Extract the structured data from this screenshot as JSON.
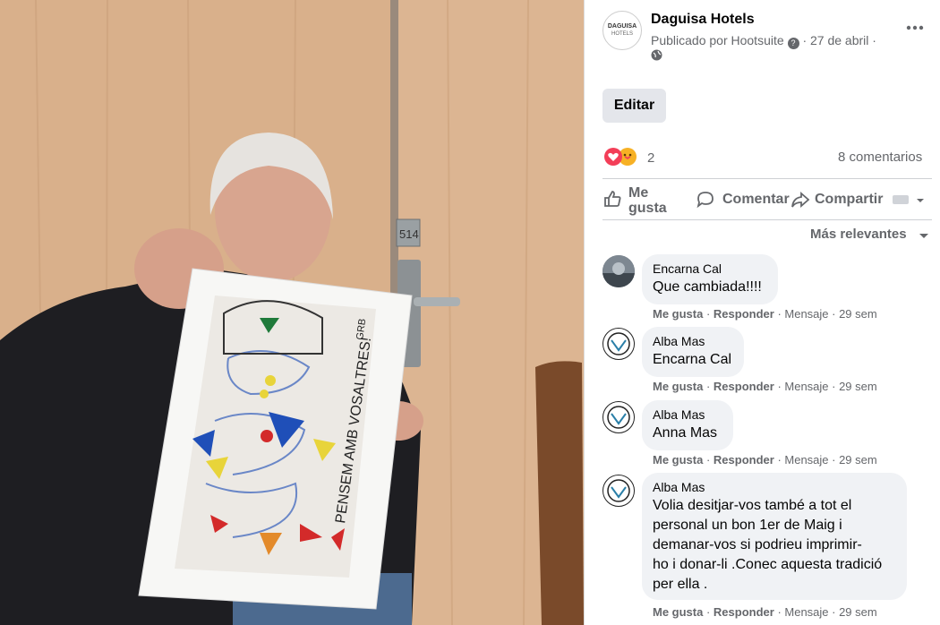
{
  "post": {
    "page_name": "Daguisa Hotels",
    "avatar_text": "DAGUISA",
    "avatar_subtext": "HOTELS",
    "published_by": "Publicado por Hootsuite",
    "date": "27 de abril",
    "dot": "·",
    "more_icon": "more-dots-icon",
    "edit_label": "Editar"
  },
  "reactions": {
    "count": "2",
    "comments_label": "8 comentarios"
  },
  "actions": {
    "like": "Me gusta",
    "comment": "Comentar",
    "share": "Compartir"
  },
  "sort_label": "Más relevantes",
  "comments": [
    {
      "author": "Encarna Cal",
      "text": "Que cambiada!!!!",
      "like": "Me gusta",
      "reply": "Responder",
      "extra": "· Mensaje · 29 sem"
    },
    {
      "author": "Alba Mas",
      "text": "Encarna Cal",
      "like": "Me gusta",
      "reply": "Responder",
      "extra": "· Mensaje · 29 sem"
    },
    {
      "author": "Alba Mas",
      "text": "Anna Mas",
      "like": "Me gusta",
      "reply": "Responder",
      "extra": "· Mensaje · 29 sem"
    },
    {
      "author": "Alba Mas",
      "text_lines": [
        "Volia desitjar-vos també a tot el",
        "personal un bon 1er de Maig i",
        "demanar-vos si podrieu imprimir-",
        "ho i donar-li .Conec aquesta tradició",
        "per ella ."
      ],
      "like": "Me gusta",
      "reply": "Responder",
      "extra": "· Mensaje · 29 sem"
    }
  ],
  "photo": {
    "door_sign": "514",
    "drawing_text": "PENSEM AMB VOSALTRES!",
    "drawing_initials": "GRB"
  },
  "colors": {
    "link": "#65676b",
    "love": "#f33e58",
    "haha": "#f7b125",
    "blue": "#1877f2"
  }
}
